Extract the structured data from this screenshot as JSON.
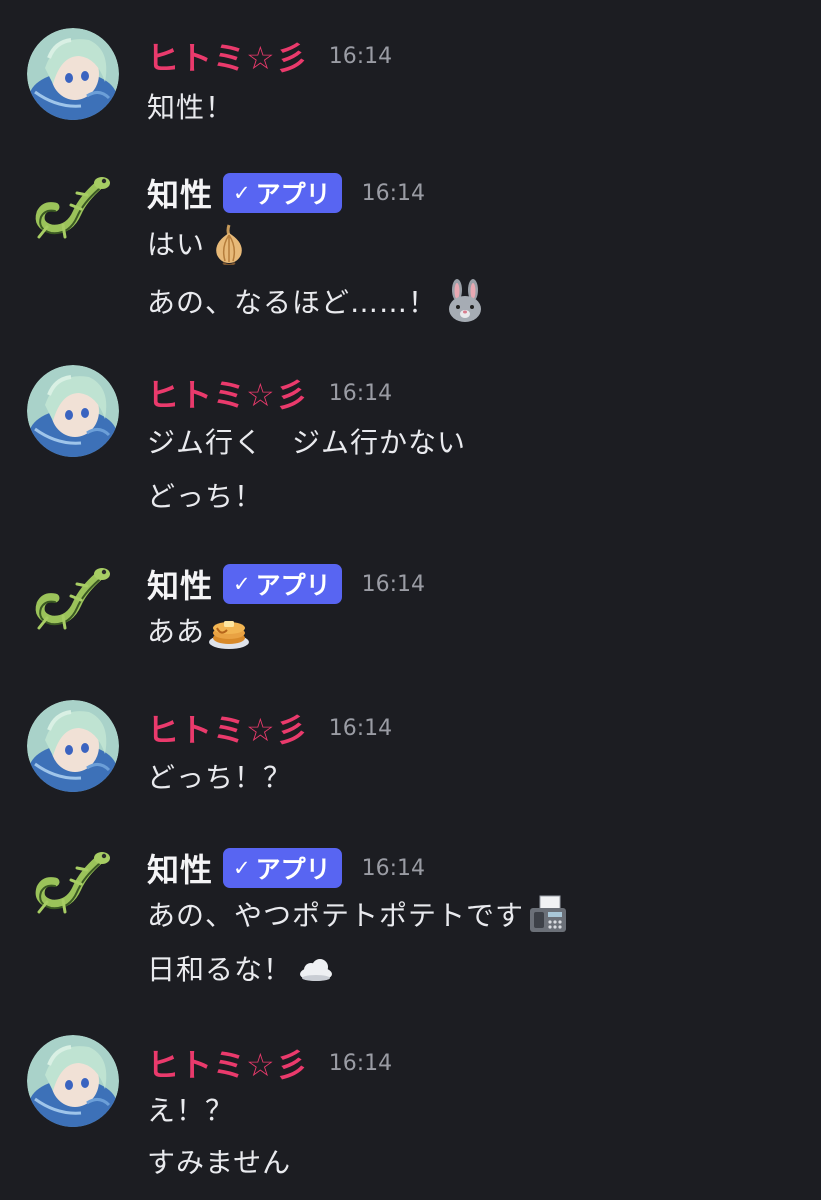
{
  "chat": {
    "users": {
      "hitomi": {
        "name": "ヒトミ☆彡",
        "name_color": "#ea3a6c"
      },
      "chisei": {
        "name": "知性",
        "badge": "アプリ",
        "badge_check": "✓",
        "name_color": "#f4f4f6"
      }
    },
    "badge_color": "#5865f2",
    "background_color": "#1c1d22",
    "messages": [
      {
        "author": "ヒトミ☆彡",
        "time": "16:14",
        "lines": [
          "知性！"
        ]
      },
      {
        "author": "知性",
        "badge": "アプリ",
        "time": "16:14",
        "lines": [
          "はい",
          "あの、なるほど……！"
        ],
        "emojis": [
          "onion",
          "rabbit-face"
        ]
      },
      {
        "author": "ヒトミ☆彡",
        "time": "16:14",
        "lines": [
          "ジム行く　ジム行かない",
          "どっち！"
        ]
      },
      {
        "author": "知性",
        "badge": "アプリ",
        "time": "16:14",
        "lines": [
          "ああ"
        ],
        "emojis": [
          "pancakes"
        ]
      },
      {
        "author": "ヒトミ☆彡",
        "time": "16:14",
        "lines": [
          "どっち！？"
        ]
      },
      {
        "author": "知性",
        "badge": "アプリ",
        "time": "16:14",
        "lines": [
          "あの、やつポテトポテトです",
          "日和るな！"
        ],
        "emojis": [
          "fax-machine",
          "cloud"
        ]
      },
      {
        "author": "ヒトミ☆彡",
        "time": "16:14",
        "lines": [
          "え！？",
          "すみません"
        ]
      }
    ]
  }
}
